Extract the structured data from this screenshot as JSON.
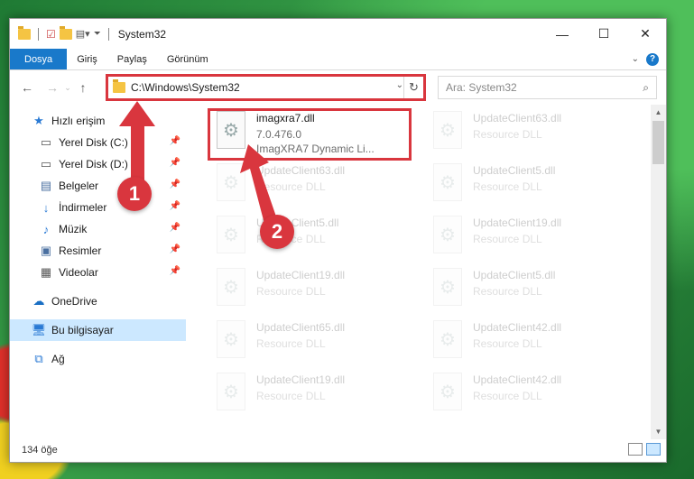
{
  "window": {
    "title": "System32",
    "controls": {
      "minimize": "—",
      "maximize": "☐",
      "close": "✕"
    }
  },
  "ribbon": {
    "tabs": [
      "Dosya",
      "Giriş",
      "Paylaş",
      "Görünüm"
    ],
    "help_label": "?"
  },
  "address": {
    "path": "C:\\Windows\\System32",
    "refresh": "↻"
  },
  "search": {
    "placeholder": "Ara: System32"
  },
  "sidebar": {
    "quick_access": "Hızlı erişim",
    "items": [
      {
        "label": "Yerel Disk (C:)",
        "icon": "drive-icon"
      },
      {
        "label": "Yerel Disk (D:)",
        "icon": "drive-icon"
      },
      {
        "label": "Belgeler",
        "icon": "document-icon"
      },
      {
        "label": "İndirmeler",
        "icon": "download-icon"
      },
      {
        "label": "Müzik",
        "icon": "music-icon"
      },
      {
        "label": "Resimler",
        "icon": "pictures-icon"
      },
      {
        "label": "Videolar",
        "icon": "video-icon"
      }
    ],
    "onedrive": "OneDrive",
    "this_pc": "Bu bilgisayar",
    "network": "Ağ"
  },
  "files": {
    "left": [
      {
        "name": "imagxra7.dll",
        "line2": "7.0.476.0",
        "line3": "ImagXRA7 Dynamic Li..."
      },
      {
        "name": "UpdateClient63.dll",
        "line2": "Resource DLL"
      },
      {
        "name": "UpdateClient5.dll",
        "line2": "Resource DLL"
      },
      {
        "name": "UpdateClient19.dll",
        "line2": "Resource DLL"
      },
      {
        "name": "UpdateClient65.dll",
        "line2": "Resource DLL"
      },
      {
        "name": "UpdateClient19.dll",
        "line2": "Resource DLL"
      }
    ],
    "right": [
      {
        "name": "UpdateClient63.dll",
        "line2": "Resource DLL"
      },
      {
        "name": "UpdateClient5.dll",
        "line2": "Resource DLL"
      },
      {
        "name": "UpdateClient19.dll",
        "line2": "Resource DLL"
      },
      {
        "name": "UpdateClient5.dll",
        "line2": "Resource DLL"
      },
      {
        "name": "UpdateClient42.dll",
        "line2": "Resource DLL"
      },
      {
        "name": "UpdateClient42.dll",
        "line2": "Resource DLL"
      }
    ]
  },
  "status": {
    "count": "134 öğe"
  },
  "annotations": {
    "step1": "1",
    "step2": "2"
  },
  "colors": {
    "accent": "#1979ca",
    "highlight_red": "#d9363e",
    "selection": "#cce8ff"
  }
}
